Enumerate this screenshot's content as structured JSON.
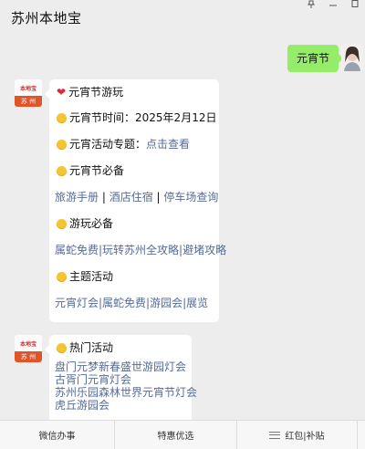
{
  "header": {
    "title": "苏州本地宝"
  },
  "user_message": "元宵节",
  "bot": {
    "avatar_logo": "本地宝",
    "avatar_city": "苏 州"
  },
  "message1": {
    "title": "元宵节游玩",
    "time_label": "元宵节时间：",
    "time_value": "2025年2月12日",
    "topic_label": "元宵活动专题：",
    "topic_link": "点击查看",
    "must_title": "元宵节必备",
    "must_links": [
      "旅游手册",
      "酒店住宿",
      "停车场查询"
    ],
    "play_title": "游玩必备",
    "play_links_text": "属蛇免费|玩转苏州全攻略|避堵攻略",
    "theme_title": "主题活动",
    "theme_links_text": "元宵灯会|属蛇免费|游园会|展览"
  },
  "message2": {
    "title": "热门活动",
    "links": [
      "盘门元梦新春盛世游园灯会",
      "古胥门元宵灯会",
      "苏州乐园森林世界元宵节灯会",
      "虎丘游园会"
    ]
  },
  "bottom_menu": {
    "item1": "微信办事",
    "item2": "特惠优选",
    "item3": "红包|补贴"
  }
}
